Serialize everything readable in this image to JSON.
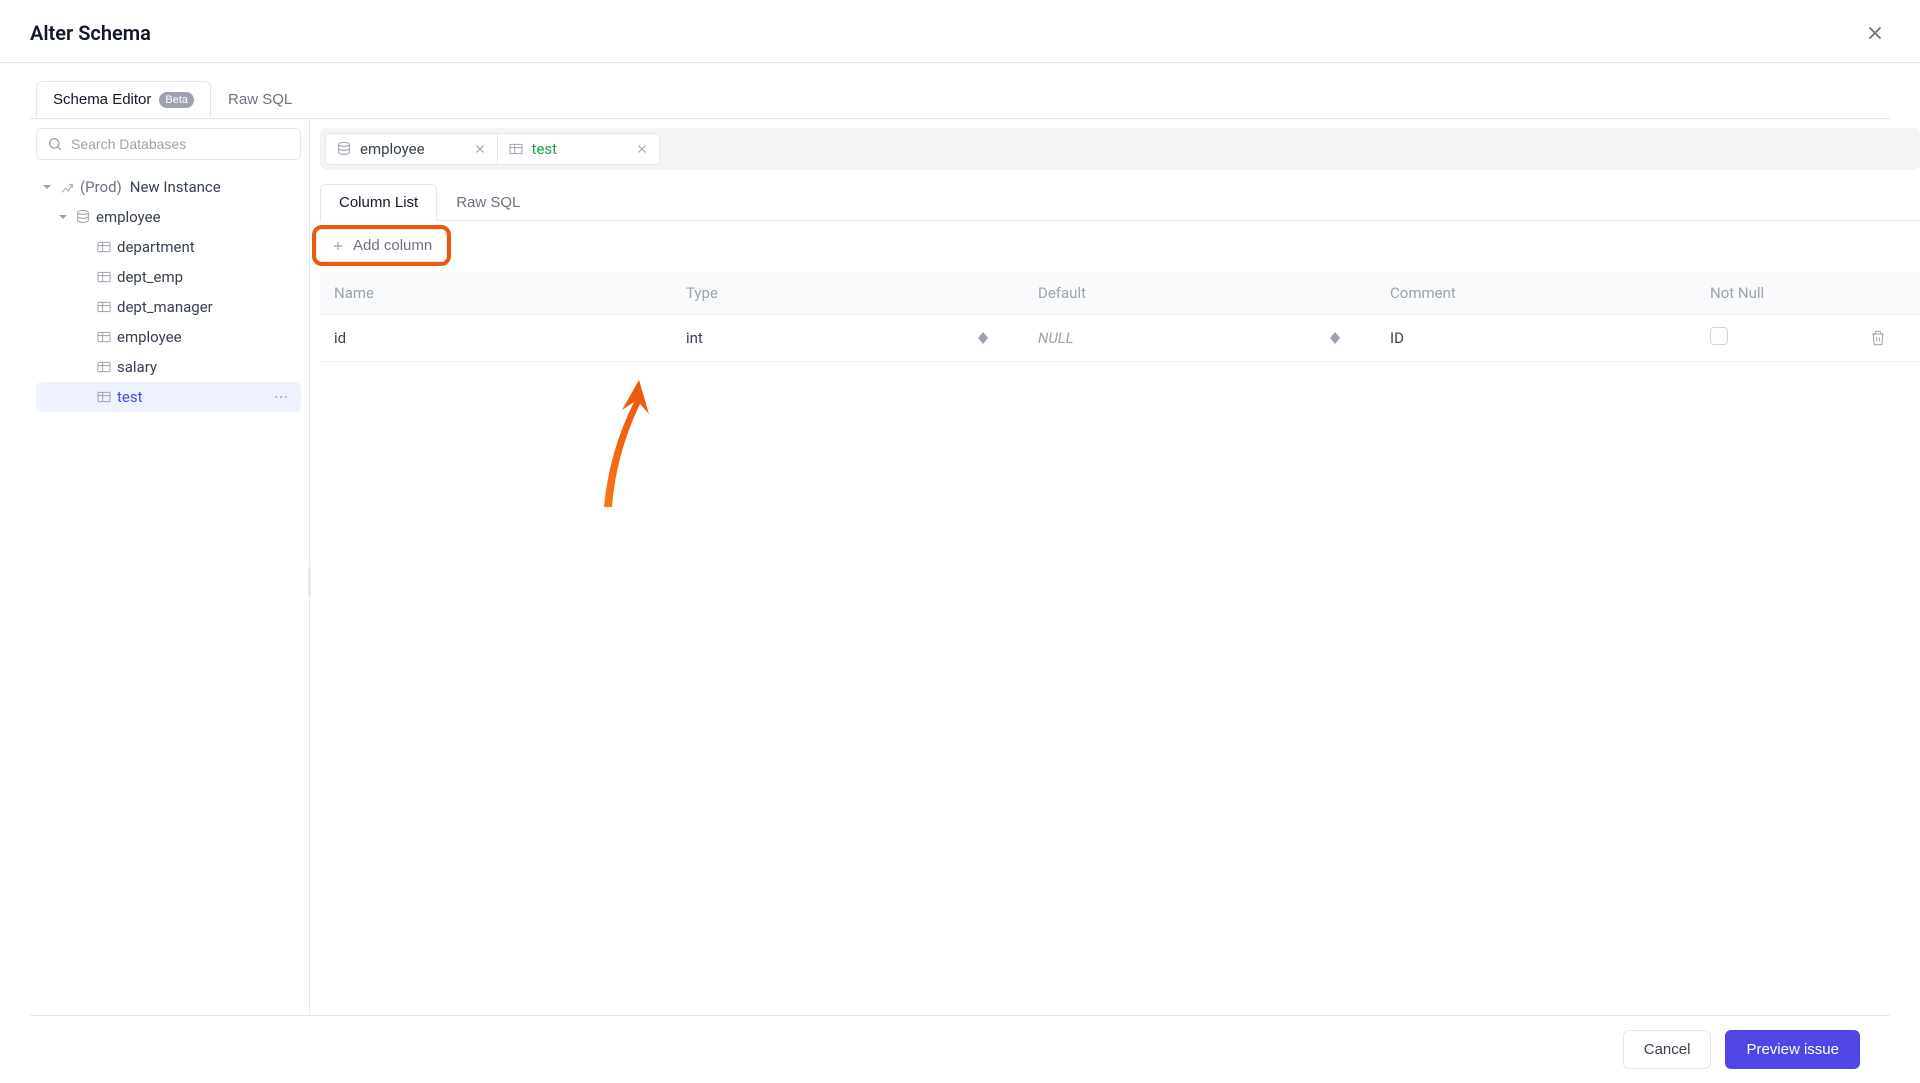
{
  "modal": {
    "title": "Alter Schema"
  },
  "top_tabs": {
    "schema_editor": "Schema Editor",
    "beta": "Beta",
    "raw_sql": "Raw SQL"
  },
  "sidebar": {
    "search_placeholder": "Search Databases",
    "instance_env": "(Prod)",
    "instance_name": "New Instance",
    "database": "employee",
    "tables": {
      "department": "department",
      "dept_emp": "dept_emp",
      "dept_manager": "dept_manager",
      "employee": "employee",
      "salary": "salary",
      "test": "test"
    }
  },
  "breadcrumb": {
    "database": "employee",
    "table": "test"
  },
  "inner_tabs": {
    "column_list": "Column List",
    "raw_sql": "Raw SQL"
  },
  "add_column_label": "Add column",
  "columns": {
    "headers": {
      "name": "Name",
      "type": "Type",
      "default": "Default",
      "comment": "Comment",
      "not_null": "Not Null"
    },
    "rows": [
      {
        "name": "id",
        "type": "int",
        "default": "NULL",
        "comment": "ID",
        "not_null": false
      }
    ]
  },
  "footer": {
    "cancel": "Cancel",
    "preview": "Preview issue"
  }
}
